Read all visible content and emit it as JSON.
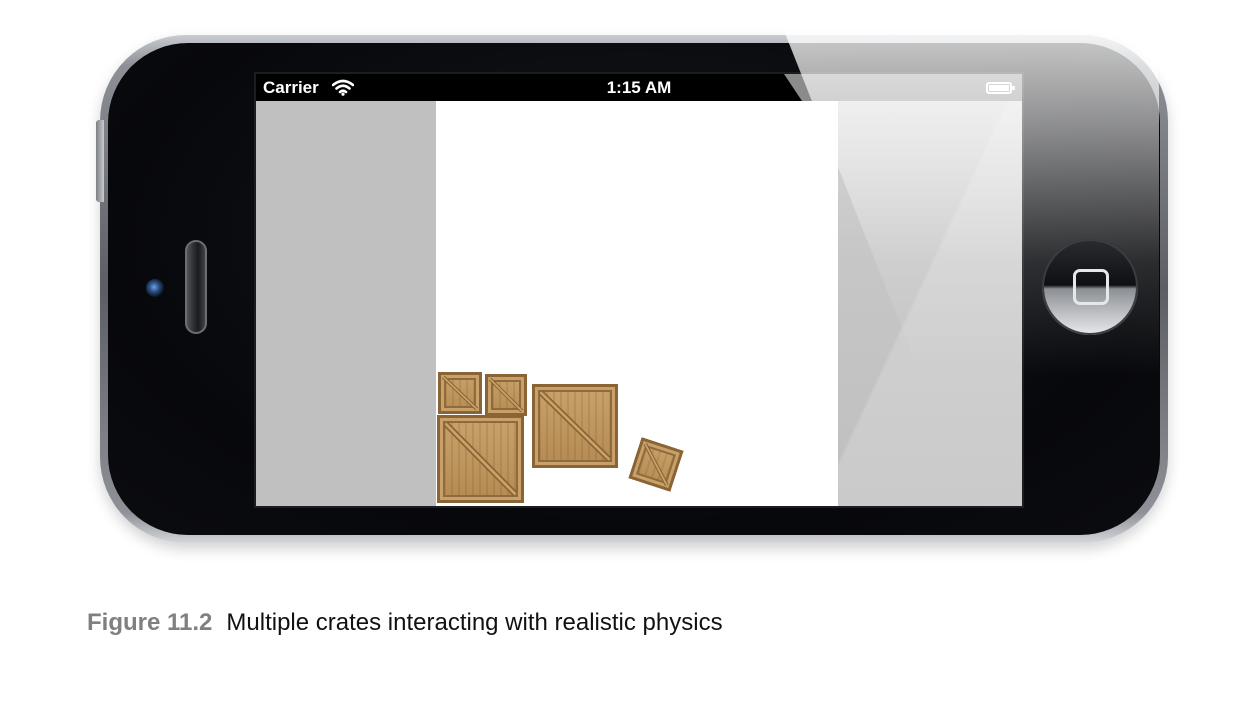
{
  "status_bar": {
    "carrier": "Carrier",
    "time": "1:15 AM",
    "wifi_icon": "wifi-icon",
    "battery_icon": "battery-full-icon"
  },
  "scene": {
    "background": "#ffffff",
    "side_background": "#c0c0c0",
    "crates": [
      {
        "name": "crate-1",
        "rotation_deg": 0
      },
      {
        "name": "crate-2",
        "rotation_deg": 0
      },
      {
        "name": "crate-3",
        "rotation_deg": 0
      },
      {
        "name": "crate-4",
        "rotation_deg": 0
      },
      {
        "name": "crate-5",
        "rotation_deg": 18
      }
    ]
  },
  "device": {
    "home_button_icon": "home-button-icon",
    "camera_icon": "camera-icon",
    "speaker_icon": "speaker-icon"
  },
  "caption": {
    "label": "Figure 11.2",
    "text": "Multiple crates interacting with realistic physics"
  }
}
